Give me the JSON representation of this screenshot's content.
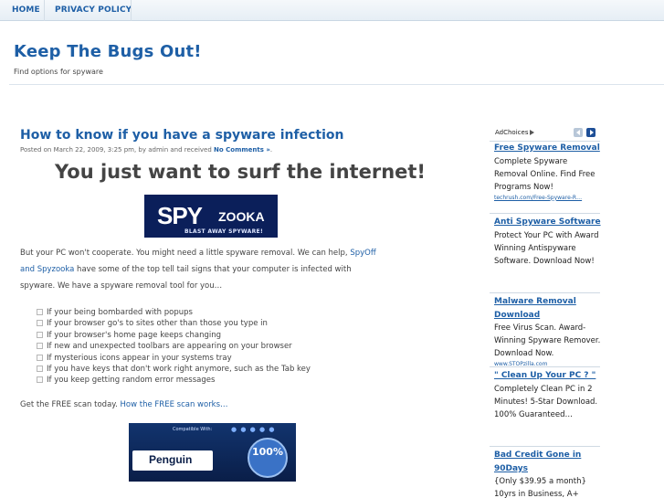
{
  "nav": {
    "home": "HOME",
    "privacy": "PRIVACY POLICY"
  },
  "site": {
    "title": "Keep The Bugs Out!",
    "tagline": "Find options for spyware"
  },
  "post": {
    "title": "How to know if you have a spyware infection",
    "meta_prefix": "Posted on March 22, 2009, 3:25 pm, by admin and received ",
    "meta_link": "No Comments »",
    "meta_suffix": ".",
    "headline": "You just want to surf the internet!",
    "banner1": {
      "logo_a": "SPY",
      "logo_b": "ZOOKA",
      "tagline": "BLAST AWAY SPYWARE!"
    },
    "p1_a": "But your PC won't cooperate.  You might need a little spyware removal.  We can help, ",
    "p1_link1": "SpyOff",
    "p2_link2": "and Spyzooka",
    "p2_b": " have some of the top tell tail signs that your computer is infected with",
    "p3": "spyware.  We have a spyware removal tool for you…",
    "list": [
      "If your being bombarded with popups",
      "If your browser go's to sites other than those you type in",
      "If your browser's home page keeps changing",
      "If new and unexpected toolbars are appearing on your browser",
      "If mysterious icons appear in your systems tray",
      "If you have keys that don't work right anymore, such as the Tab key",
      "If you keep getting random error messages"
    ],
    "scan_text": "Get the FREE scan today.  ",
    "scan_link": "How the FREE scan works…",
    "banner2": {
      "compat": "Compatible With:",
      "brand": "Penguin",
      "pct": "100%"
    }
  },
  "sidebar": {
    "adchoices": "AdChoices",
    "ads": [
      {
        "title": "Free Spyware Removal",
        "desc": "Complete Spyware Removal Online. Find Free Programs Now!",
        "url": "techrush.com/Free-Spyware-R…"
      },
      {
        "title": "Anti Spyware Software",
        "desc": "Protect Your PC with Award Winning Antispyware Software. Download Now!",
        "url": ""
      },
      {
        "title": "Malware Removal Download",
        "desc": "Free Virus Scan. Award-Winning Spyware Remover. Download Now.",
        "url": "www.STOPzilla.com"
      },
      {
        "title": "\" Clean Up Your PC ? \"",
        "desc": "Completely Clean PC in 2 Minutes! 5-Star Download. 100% Guaranteed…",
        "url": ""
      },
      {
        "title": "Bad Credit Gone in 90Days",
        "desc": "{Only $39.95 a month} 10yrs in Business, A+",
        "url": ""
      }
    ]
  }
}
